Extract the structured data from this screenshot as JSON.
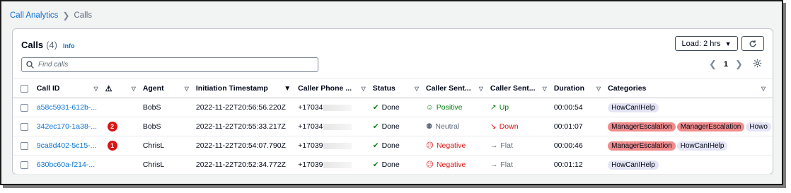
{
  "breadcrumb": {
    "root": "Call Analytics",
    "current": "Calls"
  },
  "header": {
    "title": "Calls",
    "count": "(4)",
    "info_label": "Info",
    "load_label": "Load: 2 hrs"
  },
  "search": {
    "placeholder": "Find calls"
  },
  "pagination": {
    "current_page": "1"
  },
  "columns": [
    "Call ID",
    "",
    "Agent",
    "Initiation Timestamp",
    "Caller Phone ...",
    "Status",
    "Caller Sent...",
    "Caller Sent...",
    "Duration",
    "Categories"
  ],
  "rows": [
    {
      "call_id": "a58c5931-612b-...",
      "alerts": "",
      "agent": "BobS",
      "timestamp": "2022-11-22T20:56:56.220Z",
      "phone": "+17034",
      "status": "Done",
      "sentiment": "Positive",
      "trend": "Up",
      "duration": "00:00:54",
      "categories": [
        "HowCanIHelp"
      ]
    },
    {
      "call_id": "342ec170-1a38-...",
      "alerts": "2",
      "agent": "BobS",
      "timestamp": "2022-11-22T20:55:33.217Z",
      "phone": "+17034",
      "status": "Done",
      "sentiment": "Neutral",
      "trend": "Down",
      "duration": "00:01:07",
      "categories": [
        "ManagerEscalation",
        "ManagerEscalation",
        "Howo"
      ]
    },
    {
      "call_id": "9ca8d402-5c15-...",
      "alerts": "1",
      "agent": "ChrisL",
      "timestamp": "2022-11-22T20:54:07.790Z",
      "phone": "+17039",
      "status": "Done",
      "sentiment": "Negative",
      "trend": "Flat",
      "duration": "00:00:46",
      "categories": [
        "ManagerEscalation",
        "HowCanIHelp"
      ]
    },
    {
      "call_id": "630bc60a-f214-...",
      "alerts": "",
      "agent": "ChrisL",
      "timestamp": "2022-11-22T20:52:34.772Z",
      "phone": "+17039",
      "status": "Done",
      "sentiment": "Negative",
      "trend": "Flat",
      "duration": "00:01:12",
      "categories": [
        "HowCanIHelp"
      ]
    }
  ],
  "colors": {
    "link": "#0972d3",
    "positive": "#037f0c",
    "negative": "#d91515",
    "escalation_tag": "#f08c8c",
    "category_tag": "#e4e4f4"
  }
}
